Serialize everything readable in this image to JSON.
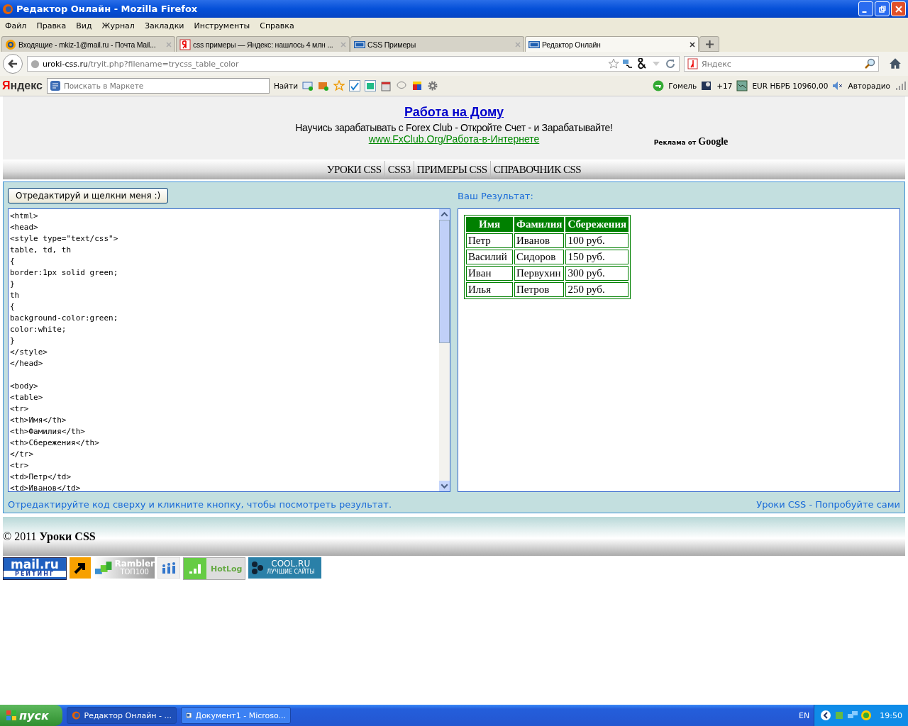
{
  "window": {
    "title": "Редактор Онлайн - Mozilla Firefox"
  },
  "menu": [
    "Файл",
    "Правка",
    "Вид",
    "Журнал",
    "Закладки",
    "Инструменты",
    "Справка"
  ],
  "tabs": [
    {
      "label": "Входящие - mkiz-1@mail.ru - Почта Mail...",
      "selected": false,
      "kind": "mail"
    },
    {
      "label": "css примеры — Яндекс: нашлось 4 млн ...",
      "selected": false,
      "kind": "yandex"
    },
    {
      "label": "CSS Примеры",
      "selected": false,
      "kind": "css"
    },
    {
      "label": "Редактор Онлайн",
      "selected": true,
      "kind": "css"
    }
  ],
  "address": {
    "host": "uroki-css.ru",
    "path": "/tryit.php?filename=trycss_table_color"
  },
  "search": {
    "placeholder": "Яндекс"
  },
  "yandex_bar": {
    "logo": "Яндекс",
    "placeholder": "Поискать в Маркете",
    "find": "Найти",
    "city": "Гомель",
    "temperature": "+17",
    "rate": "EUR НБРБ 10960,00",
    "radio": "Авторадио"
  },
  "ad": {
    "title": "Работа на Дому",
    "text": "Научись зарабатывать с Forex Club - Откройте Счет - и Зарабатывайте!",
    "link": "www.FxClub.Org/Работа-в-Интернете",
    "credit_prefix": "Реклама от",
    "credit_brand": "Google"
  },
  "site_nav": [
    "УРОКИ CSS",
    "CSS3",
    "ПРИМЕРЫ CSS",
    "СПРАВОЧНИК CSS"
  ],
  "editor": {
    "button": "Отредактируй и щелкни меня :)",
    "result_label": "Ваш Результат:",
    "code_blocks": [
      [
        "<html>",
        "<head>",
        "<style type=\"text/css\">",
        "table, td, th",
        "{",
        "border:1px solid green;",
        "}",
        "th",
        "{",
        "background-color:green;",
        "color:white;",
        "}",
        "</style>",
        "</head>"
      ],
      [
        "<body>",
        "<table>",
        "<tr>",
        "<th>Имя</th>",
        "<th>Фамилия</th>",
        "<th>Сбережения</th>",
        "</tr>",
        "<tr>",
        "<td>Петр</td>",
        "<td>Иванов</td>"
      ]
    ],
    "hint": "Отредактируйте код сверху и кликните кнопку, чтобы посмотреть результат.",
    "link": "Уроки CSS - Попробуйте сами"
  },
  "result_table": {
    "columns": [
      "Имя",
      "Фамилия",
      "Сбережения"
    ],
    "rows": [
      [
        "Петр",
        "Иванов",
        "100 руб."
      ],
      [
        "Василий",
        "Сидоров",
        "150 руб."
      ],
      [
        "Иван",
        "Первухин",
        "300 руб."
      ],
      [
        "Илья",
        "Петров",
        "250 руб."
      ]
    ]
  },
  "footer": {
    "year": "© 2011",
    "name": "Уроки CSS"
  },
  "counters": [
    {
      "kind": "mailru",
      "text": "mail.ru",
      "sub": "РЕЙТИНГ"
    },
    {
      "kind": "arrow"
    },
    {
      "kind": "rambler",
      "text": "Rambler",
      "sub": "ТОП100"
    },
    {
      "kind": "people"
    },
    {
      "kind": "hotlog",
      "text": "HotLog"
    },
    {
      "kind": "cool",
      "text": "COOL.RU",
      "sub": "ЛУЧШИЕ САЙТЫ"
    }
  ],
  "taskbar": {
    "start": "пуск",
    "tasks": [
      {
        "label": "Редактор Онлайн - ...",
        "selected": true
      },
      {
        "label": "Документ1 - Microso...",
        "selected": false
      }
    ],
    "lang": "EN",
    "clock": "19:50"
  }
}
